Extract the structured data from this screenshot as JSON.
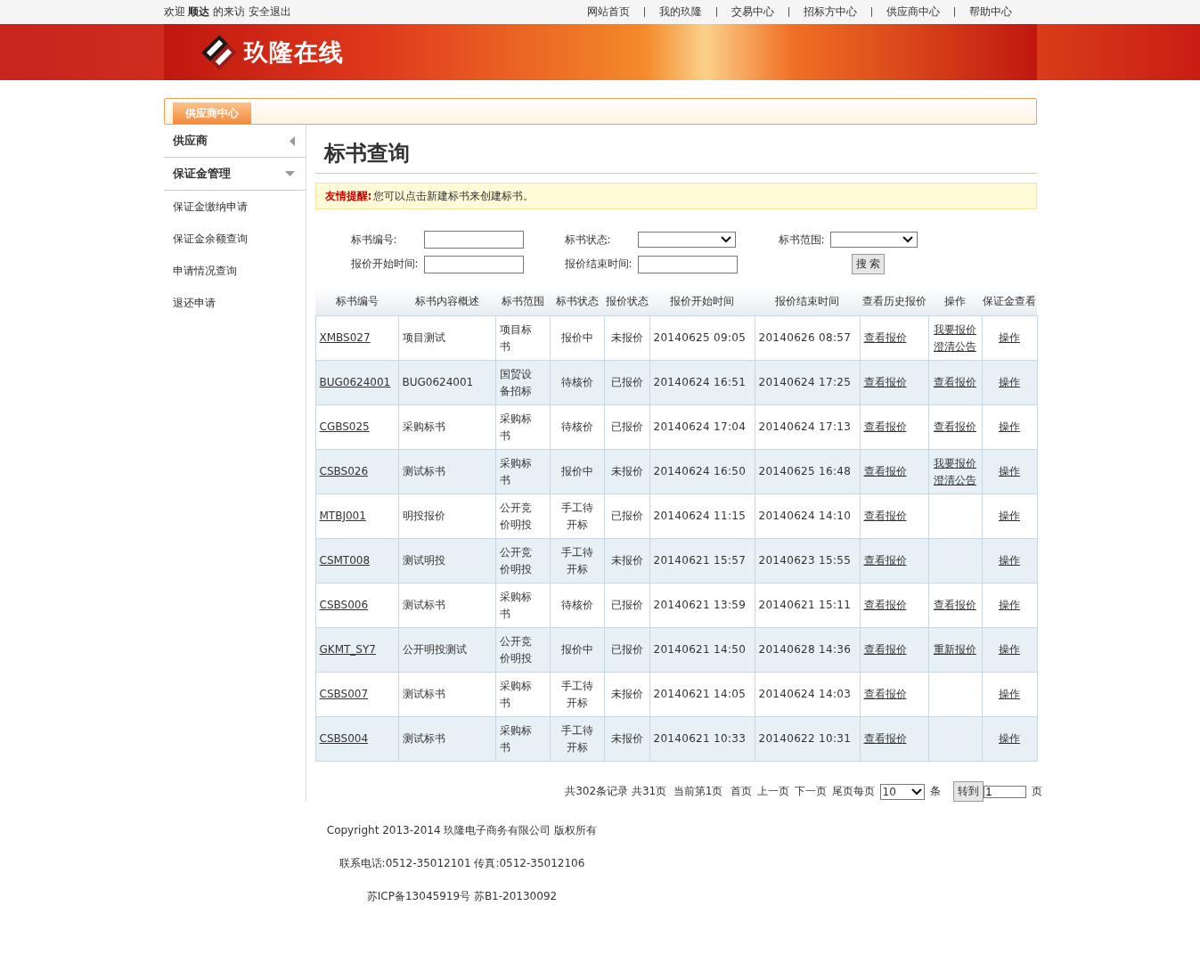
{
  "top_bar": {
    "welcome": "欢迎 **顺达** 的来访",
    "logout": "安全退出",
    "nav": [
      "网站首页",
      "我的玖隆",
      "交易中心",
      "招标方中心",
      "供应商中心",
      "帮助中心"
    ]
  },
  "banner": {
    "logo_text": "玖隆在线"
  },
  "section_tab": {
    "label": "供应商中心",
    "selected": true
  },
  "sidebar": {
    "groups": [
      {
        "label": "供应商",
        "expanded": false
      },
      {
        "label": "保证金管理",
        "expanded": true,
        "items": [
          "保证金缴纳申请",
          "保证金余额查询",
          "申请情况查询",
          "退还申请"
        ]
      }
    ]
  },
  "page_title": "标书查询",
  "notice": {
    "label": "友情提醒:",
    "text": "您可以点击新建标书来创建标书。"
  },
  "filters": [
    {
      "label": "标书编号:",
      "kind": "text"
    },
    {
      "label": "标书状态:",
      "kind": "select"
    },
    {
      "label": "标书范围:",
      "kind": "select"
    },
    {
      "label": "报价开始时间:",
      "kind": "text"
    },
    {
      "label": "报价结束时间:",
      "kind": "text"
    },
    {
      "label": "搜 索",
      "kind": "button"
    }
  ],
  "table": {
    "columns": [
      "标书编号",
      "标书内容概述",
      "标书范围",
      "标书状态",
      "报价状态",
      "报价开始时间",
      "报价结束时间",
      "查看历史报价",
      "操作",
      "保证金查看"
    ],
    "rows": [
      {
        "code": "XMBS027",
        "summary": "项目测试",
        "scope": "项目标书",
        "status": "报价中",
        "quote_status": "未报价",
        "start": "20140625 09:05",
        "end": "20140626 08:57",
        "history": "查看报价",
        "actions": [
          "我要报价",
          "澄清公告"
        ],
        "deposit": "操作"
      },
      {
        "code": "BUG0624001",
        "summary": "BUG0624001",
        "scope": "国贸设备招标",
        "status": "待核价",
        "quote_status": "已报价",
        "start": "20140624 16:51",
        "end": "20140624 17:25",
        "history": "查看报价",
        "actions": [
          "查看报价"
        ],
        "deposit": "操作"
      },
      {
        "code": "CGBS025",
        "summary": "采购标书",
        "scope": "采购标书",
        "status": "待核价",
        "quote_status": "已报价",
        "start": "20140624 17:04",
        "end": "20140624 17:13",
        "history": "查看报价",
        "actions": [
          "查看报价"
        ],
        "deposit": "操作"
      },
      {
        "code": "CSBS026",
        "summary": "测试标书",
        "scope": "采购标书",
        "status": "报价中",
        "quote_status": "未报价",
        "start": "20140624 16:50",
        "end": "20140625 16:48",
        "history": "查看报价",
        "actions": [
          "我要报价",
          "澄清公告"
        ],
        "deposit": "操作"
      },
      {
        "code": "MTBJ001",
        "summary": "明投报价",
        "scope": "公开竞价明投",
        "status": "手工待开标",
        "quote_status": "已报价",
        "start": "20140624 11:15",
        "end": "20140624 14:10",
        "history": "查看报价",
        "actions": [],
        "deposit": "操作"
      },
      {
        "code": "CSMT008",
        "summary": "测试明投",
        "scope": "公开竞价明投",
        "status": "手工待开标",
        "quote_status": "未报价",
        "start": "20140621 15:57",
        "end": "20140623 15:55",
        "history": "查看报价",
        "actions": [],
        "deposit": "操作"
      },
      {
        "code": "CSBS006",
        "summary": "测试标书",
        "scope": "采购标书",
        "status": "待核价",
        "quote_status": "已报价",
        "start": "20140621 13:59",
        "end": "20140621 15:11",
        "history": "查看报价",
        "actions": [
          "查看报价"
        ],
        "deposit": "操作"
      },
      {
        "code": "GKMT_SY7",
        "summary": "公开明投测试",
        "scope": "公开竞价明投",
        "status": "报价中",
        "quote_status": "已报价",
        "start": "20140621 14:50",
        "end": "20140628 14:36",
        "history": "查看报价",
        "actions": [
          "重新报价"
        ],
        "deposit": "操作"
      },
      {
        "code": "CSBS007",
        "summary": "测试标书",
        "scope": "采购标书",
        "status": "手工待开标",
        "quote_status": "未报价",
        "start": "20140621 14:05",
        "end": "20140624 14:03",
        "history": "查看报价",
        "actions": [],
        "deposit": "操作"
      },
      {
        "code": "CSBS004",
        "summary": "测试标书",
        "scope": "采购标书",
        "status": "手工待开标",
        "quote_status": "未报价",
        "start": "20140621 10:33",
        "end": "20140622 10:31",
        "history": "查看报价",
        "actions": [],
        "deposit": "操作"
      }
    ]
  },
  "pagination": {
    "summary": "共302条记录 共31页  当前第1页",
    "links": [
      "首页",
      "上一页",
      "下一页",
      "尾页"
    ],
    "per_page_label": "每页",
    "per_page": "10",
    "per_page_unit": "条",
    "go_button": "转到",
    "page_value": "1",
    "page_unit": "页"
  },
  "footer": [
    "Copyright 2013-2014 玖隆电子商务有限公司 版权所有",
    "联系电话:0512-35012101 传真:0512-35012106",
    "苏ICP备13045919号 苏B1-20130092"
  ]
}
